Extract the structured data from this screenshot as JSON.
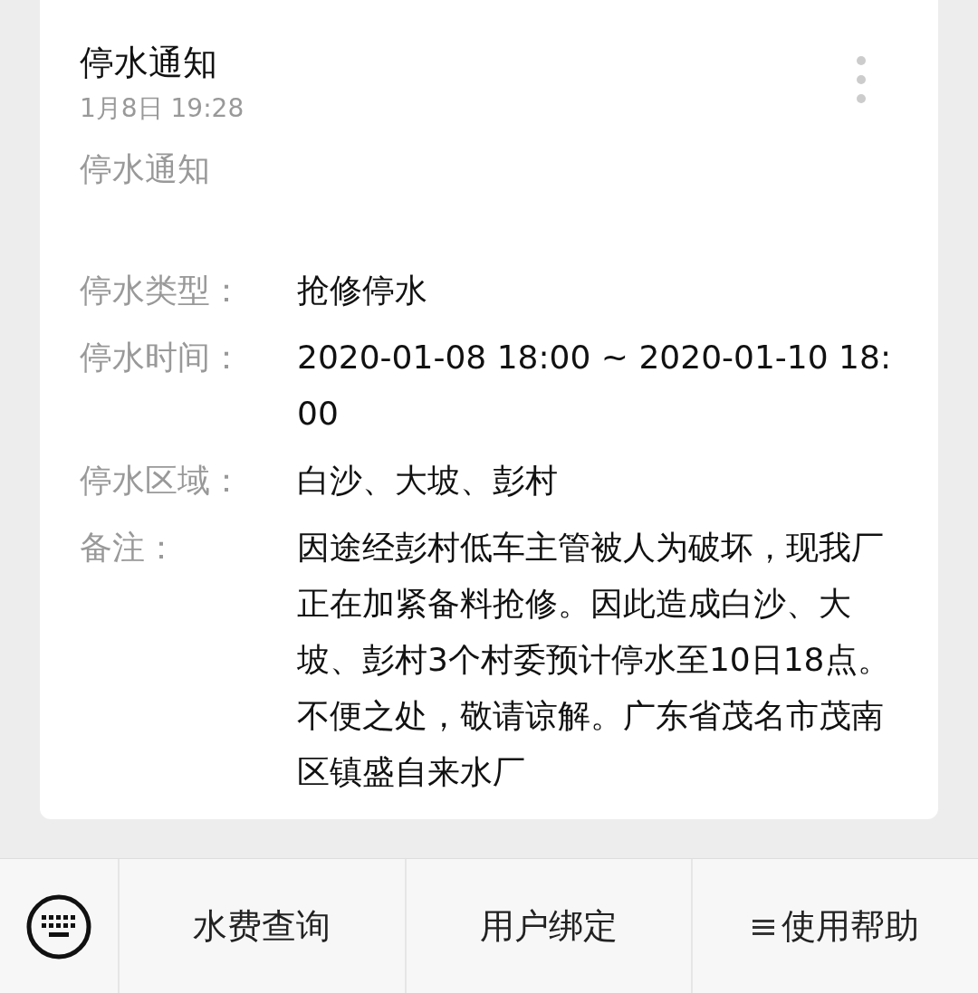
{
  "message": {
    "title": "停水通知",
    "time": "1月8日  19:28",
    "subtitle": "停水通知",
    "fields": [
      {
        "label": "停水类型：",
        "value": "抢修停水"
      },
      {
        "label": "停水时间：",
        "value": "2020-01-08 18:00 ~ 2020-01-10 18:00"
      },
      {
        "label": "停水区域：",
        "value": "白沙、大坡、彭村"
      },
      {
        "label": "备注：",
        "value": "因途经彭村低车主管被人为破坏，现我厂正在加紧备料抢修。因此造成白沙、大坡、彭村3个村委预计停水至10日18点。不便之处，敬请谅解。广东省茂名市茂南区镇盛自来水厂"
      }
    ]
  },
  "menu_bar": {
    "items": [
      {
        "label": "水费查询",
        "kind": "plain"
      },
      {
        "label": "用户绑定",
        "kind": "plain"
      },
      {
        "label": "使用帮助",
        "kind": "submenu"
      }
    ]
  }
}
